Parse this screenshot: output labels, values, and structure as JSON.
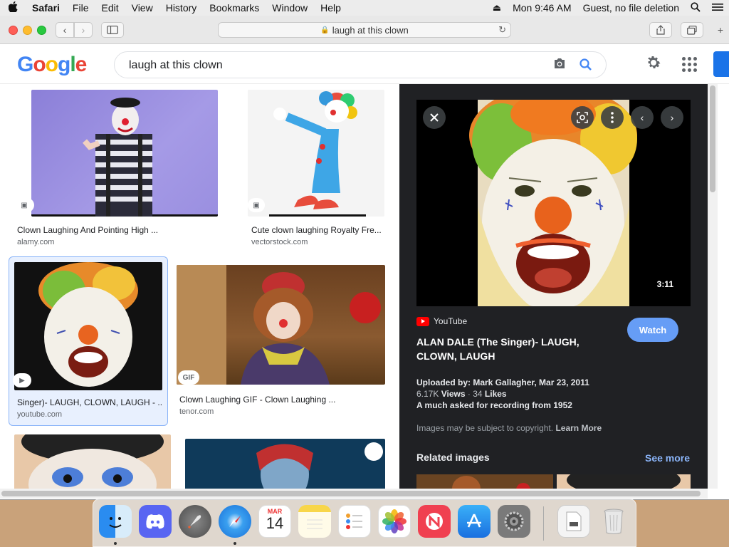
{
  "menubar": {
    "app": "Safari",
    "items": [
      "File",
      "Edit",
      "View",
      "History",
      "Bookmarks",
      "Window",
      "Help"
    ],
    "clock": "Mon 9:46 AM",
    "user": "Guest, no file deletion"
  },
  "browser": {
    "url": "laugh at this clown"
  },
  "google": {
    "logo": [
      "G",
      "o",
      "o",
      "g",
      "l",
      "e"
    ],
    "query": "laugh at this clown"
  },
  "results": [
    {
      "caption": "Clown Laughing And Pointing High ...",
      "source": "alamy.com"
    },
    {
      "caption": "Cute clown laughing Royalty Fre...",
      "source": "vectorstock.com"
    },
    {
      "caption": "Singer)- LAUGH, CLOWN, LAUGH - ...",
      "source": "youtube.com"
    },
    {
      "caption": "Clown Laughing GIF - Clown Laughing ...",
      "source": "tenor.com",
      "badge": "GIF"
    }
  ],
  "preview": {
    "duration": "3:11",
    "platform": "YouTube",
    "title": "ALAN DALE (The Singer)- LAUGH, CLOWN, LAUGH",
    "watch_label": "Watch",
    "uploaded": "Uploaded by: Mark Gallagher, Mar 23, 2011",
    "views_count": "6.17K",
    "views_label": "Views",
    "likes_count": "34",
    "likes_label": "Likes",
    "description": "A much asked for recording from 1952",
    "copyright": "Images may be subject to copyright.",
    "learn_more": "Learn More",
    "related_title": "Related images",
    "see_more": "See more"
  },
  "dock": {
    "calendar_month": "MAR",
    "calendar_day": "14"
  },
  "colors": {
    "panel_bg": "#202124",
    "link_blue": "#8ab4f8",
    "watch_btn": "#669df6",
    "selected_border": "#8ab4f8"
  }
}
